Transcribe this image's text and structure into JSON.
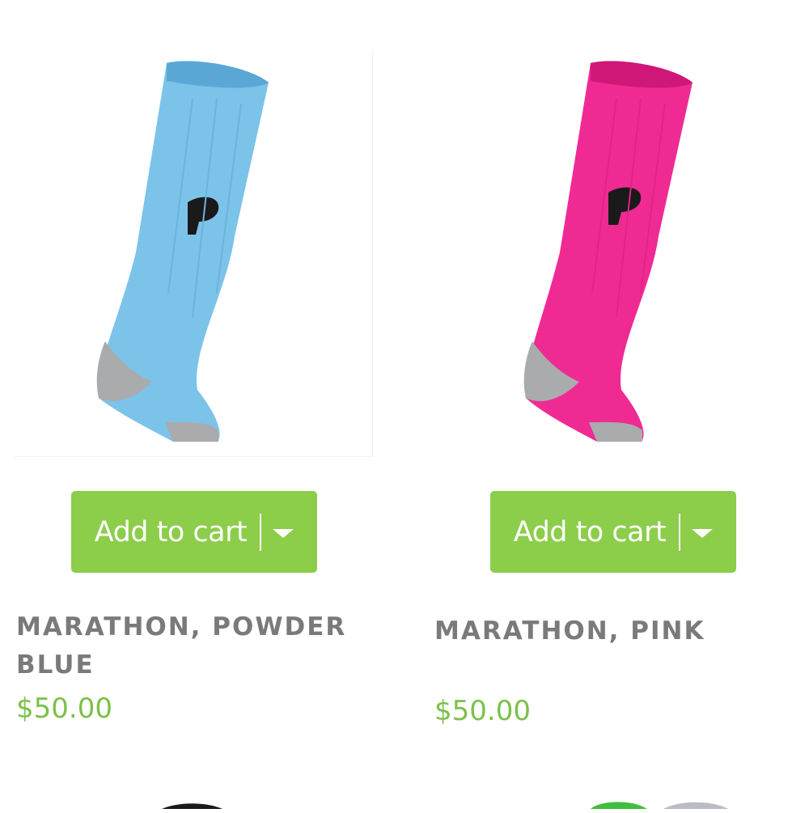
{
  "products": [
    {
      "name": "MARATHON, POWDER BLUE",
      "price": "$50.00",
      "add_to_cart_label": "Add to cart",
      "image_colors": {
        "main": "#7cc3ea",
        "shade": "#5aa7d6",
        "heel": "#a9abad"
      }
    },
    {
      "name": "MARATHON, PINK",
      "price": "$50.00",
      "add_to_cart_label": "Add to cart",
      "image_colors": {
        "main": "#f02a93",
        "shade": "#cf1777",
        "heel": "#a9abad"
      }
    }
  ],
  "colors": {
    "button": "#8ccd4a",
    "price": "#7cc04a",
    "title": "#7a7a7a"
  }
}
